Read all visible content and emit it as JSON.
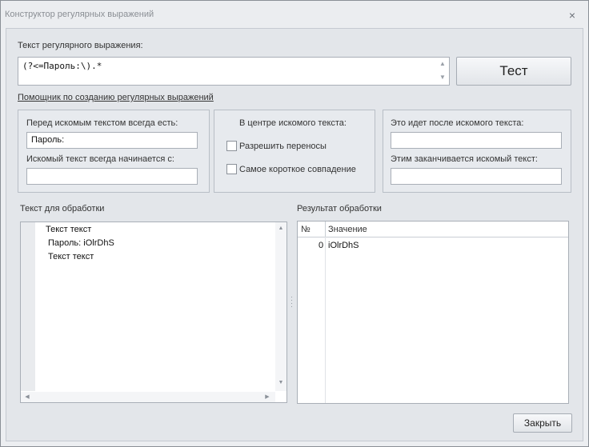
{
  "window": {
    "title": "Конструктор регулярных выражений",
    "close_glyph": "×"
  },
  "regex": {
    "label": "Текст регулярного выражения:",
    "value": "(?<=Пароль:\\).*"
  },
  "buttons": {
    "test": "Тест",
    "close": "Закрыть"
  },
  "helper_link": "Помощник по созданию регулярных выражений",
  "before_group": {
    "label_before": "Перед искомым текстом всегда есть:",
    "before_value": "Пароль:",
    "label_starts": "Искомый текст всегда начинается с:",
    "starts_value": ""
  },
  "center_group": {
    "title": "В центре искомого текста:",
    "allow_linebreaks": "Разрешить переносы",
    "shortest_match": "Самое короткое совпадение"
  },
  "after_group": {
    "label_after": "Это идет после искомого текста:",
    "after_value": "",
    "label_ends": "Этим заканчивается искомый текст:",
    "ends_value": ""
  },
  "source": {
    "label": "Текст для обработки",
    "lines": [
      "Текст текст",
      "Пароль: iOlrDhS",
      "Текст текст"
    ]
  },
  "result": {
    "label": "Результат обработки",
    "columns": [
      "№",
      "Значение"
    ],
    "rows": [
      {
        "index": "0",
        "value": "iOlrDhS"
      }
    ]
  }
}
